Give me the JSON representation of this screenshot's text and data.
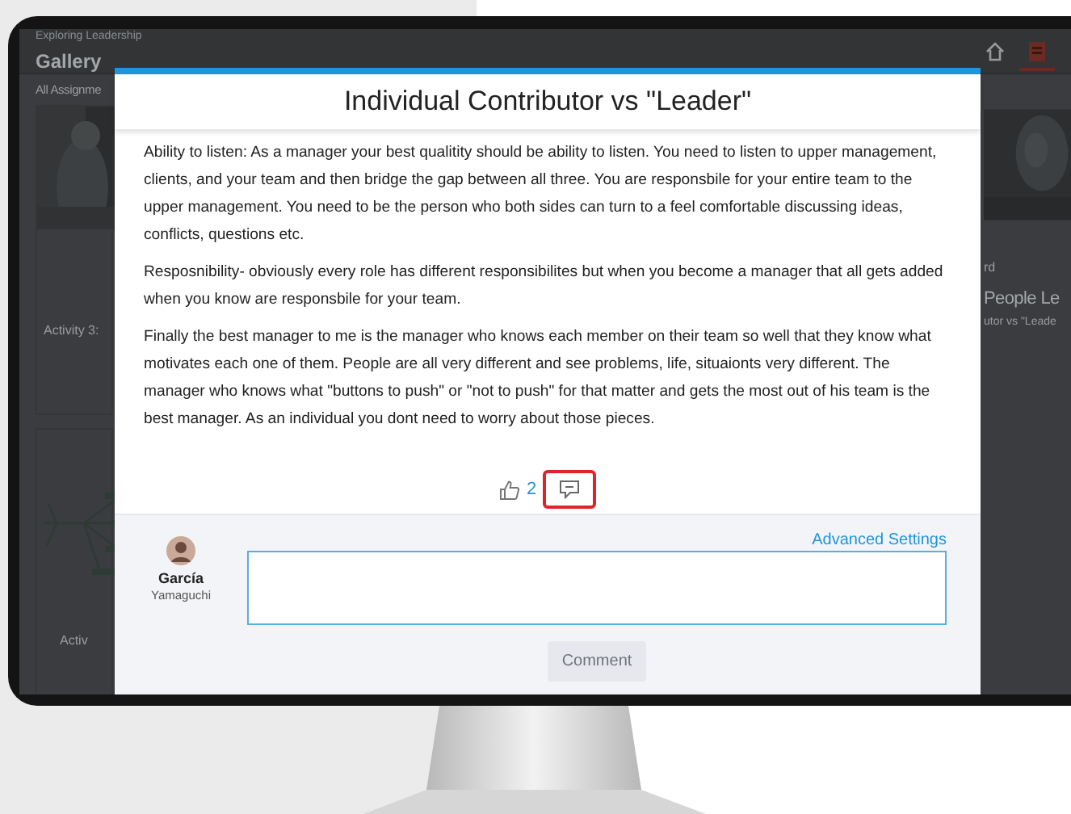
{
  "app": {
    "breadcrumb": "Exploring Leadership",
    "title": "Gallery",
    "filter": "All Assignme",
    "nav_icons": [
      {
        "kind": "home",
        "selected": false
      },
      {
        "kind": "profile",
        "selected": true
      }
    ],
    "left_cards": [
      {
        "kind": "picture",
        "caption": "Activity 3:"
      },
      {
        "kind": "mindmap",
        "caption": "Activ"
      }
    ],
    "right_card": {
      "kind": "picture",
      "subtitle": "rd",
      "title": "People Le",
      "caption": "utor vs \"Leade"
    }
  },
  "modal": {
    "title": "Individual Contributor vs \"Leader\"",
    "paragraphs": [
      "Ability to listen: As a manager your best qualitity should be ability to listen. You need to listen to upper management, clients, and your team and then bridge the gap between all three. You are responsbile for your entire team to the upper management. You need to be the person who both sides can turn to a feel comfortable discussing ideas, conflicts, questions etc.",
      "Resposnibility- obviously every role has different responsibilites but when you become a manager that all gets added when you know are responsbile for your team.",
      "Finally the best manager to me is the manager who knows each member on their team so well that they know what motivates each one of them. People are all very different and see problems, life, situaionts very different. The manager who knows what \"buttons to push\" or \"not to push\" for that matter and gets the most out of his team is the best manager. As an individual you dont need to worry about those pieces."
    ],
    "likes": "2",
    "comment_highlighted": true,
    "composer": {
      "first_name": "García",
      "last_name": "Yamaguchi",
      "advanced_link": "Advanced Settings",
      "button": "Comment",
      "button_disabled": true
    }
  }
}
